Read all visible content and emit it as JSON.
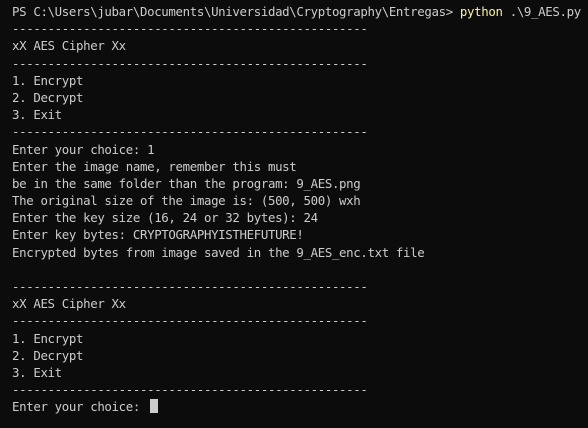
{
  "prompt": {
    "path": "PS C:\\Users\\jubar\\Documents\\Universidad\\Cryptography\\Entregas> ",
    "command": "python",
    "args": " .\\9_AES.py"
  },
  "separator": "--------------------------------------------------",
  "menu_title": "xX AES Cipher Xx",
  "menu_items": [
    "1. Encrypt",
    "2. Decrypt",
    "3. Exit"
  ],
  "session": [
    "Enter your choice: 1",
    "Enter the image name, remember this must",
    "be in the same folder than the program: 9_AES.png",
    "The original size of the image is: (500, 500) wxh",
    "Enter the key size (16, 24 or 32 bytes): 24",
    "Enter key bytes: CRYPTOGRAPHYISTHEFUTURE!",
    "Encrypted bytes from image saved in the 9_AES_enc.txt file"
  ],
  "final_prompt": "Enter your choice: "
}
